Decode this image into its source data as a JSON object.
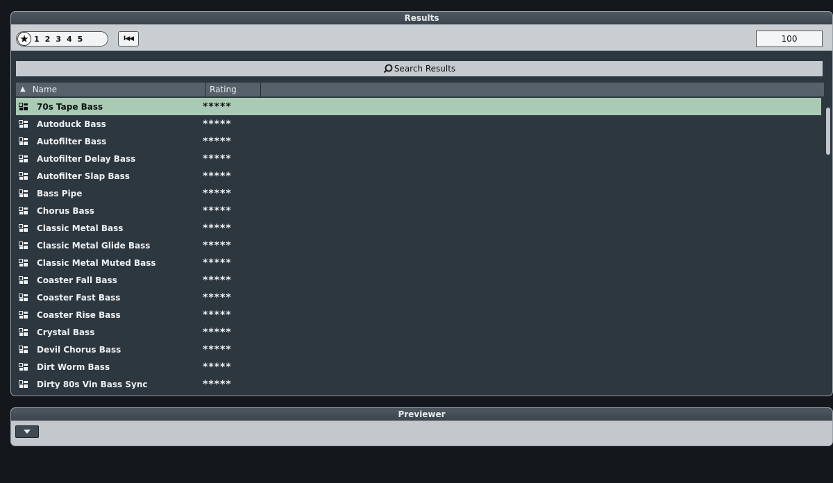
{
  "results": {
    "title": "Results",
    "rating_filter": {
      "icon": "star-icon",
      "options": [
        "1",
        "2",
        "3",
        "4",
        "5"
      ]
    },
    "rewind_label": "I◀◀",
    "result_count": "100",
    "search_label": "Search Results",
    "columns": {
      "name": "Name",
      "rating": "Rating"
    },
    "items": [
      {
        "name": "70s Tape Bass",
        "rating": "*****",
        "selected": true
      },
      {
        "name": "Autoduck Bass",
        "rating": "*****"
      },
      {
        "name": "Autofilter Bass",
        "rating": "*****"
      },
      {
        "name": "Autofilter Delay Bass",
        "rating": "*****"
      },
      {
        "name": "Autofilter Slap Bass",
        "rating": "*****"
      },
      {
        "name": "Bass Pipe",
        "rating": "*****"
      },
      {
        "name": "Chorus Bass",
        "rating": "*****"
      },
      {
        "name": "Classic Metal Bass",
        "rating": "*****"
      },
      {
        "name": "Classic Metal Glide Bass",
        "rating": "*****"
      },
      {
        "name": "Classic Metal Muted Bass",
        "rating": "*****"
      },
      {
        "name": "Coaster Fall Bass",
        "rating": "*****"
      },
      {
        "name": "Coaster Fast Bass",
        "rating": "*****"
      },
      {
        "name": "Coaster Rise Bass",
        "rating": "*****"
      },
      {
        "name": "Crystal Bass",
        "rating": "*****"
      },
      {
        "name": "Devil Chorus Bass",
        "rating": "*****"
      },
      {
        "name": "Dirt Worm Bass",
        "rating": "*****"
      },
      {
        "name": "Dirty 80s Vin Bass Sync",
        "rating": "*****"
      }
    ]
  },
  "previewer": {
    "title": "Previewer"
  },
  "colors": {
    "selected_row": "#a9cbb5",
    "list_background": "#2d3740"
  }
}
